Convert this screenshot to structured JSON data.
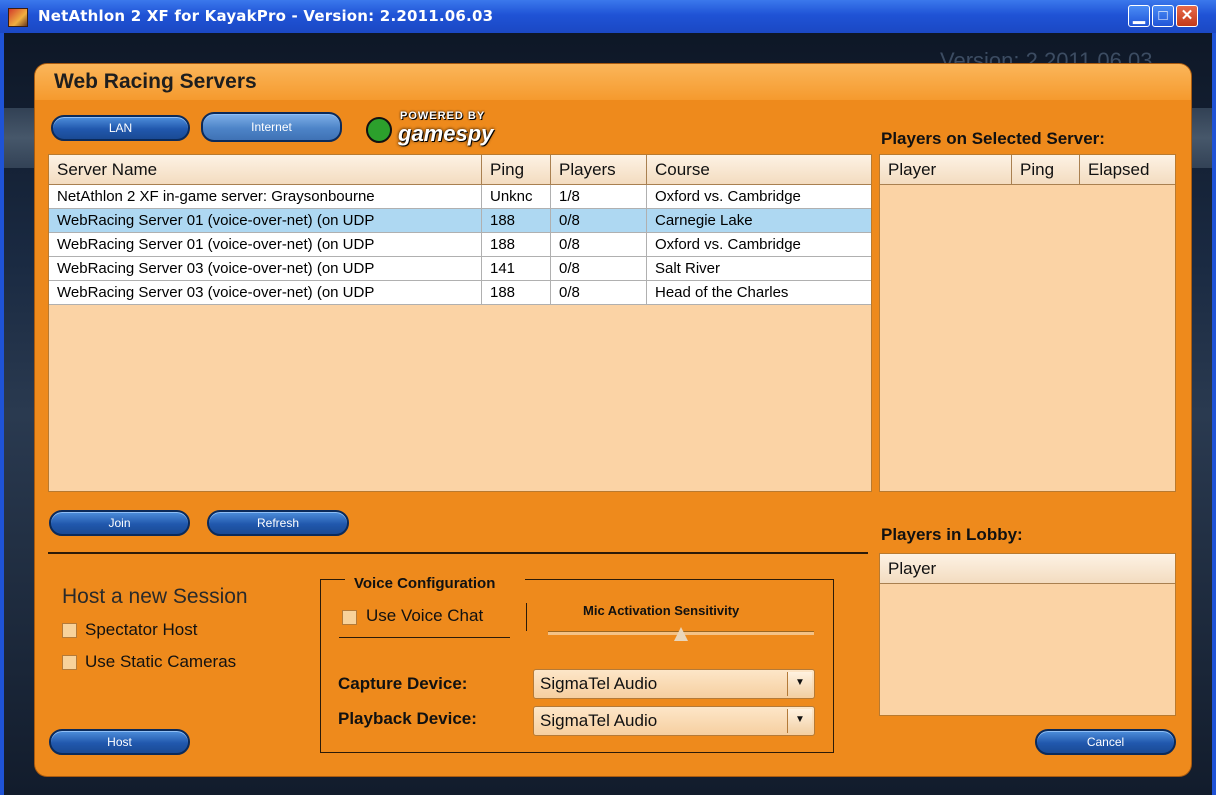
{
  "window": {
    "title": "NetAthlon 2 XF for KayakPro - Version: 2.2011.06.03",
    "background_version": "Version: 2.2011.06.03",
    "controls": [
      "minimize",
      "maximize",
      "close"
    ]
  },
  "dialog": {
    "title": "Web Racing Servers",
    "tabs": {
      "lan": "LAN",
      "internet": "Internet"
    },
    "logo": {
      "powered_by": "POWERED BY",
      "name": "gamespy"
    }
  },
  "servers": {
    "columns": [
      "Server Name",
      "Ping",
      "Players",
      "Course"
    ],
    "rows": [
      {
        "name": "NetAthlon 2 XF in-game server: Graysonbourne",
        "ping": "Unknc",
        "players": "1/8",
        "course": "Oxford vs. Cambridge",
        "selected": false
      },
      {
        "name": "WebRacing Server 01 (voice-over-net) (on UDP",
        "ping": "188",
        "players": "0/8",
        "course": "Carnegie Lake",
        "selected": true
      },
      {
        "name": "WebRacing Server 01 (voice-over-net) (on UDP",
        "ping": "188",
        "players": "0/8",
        "course": "Oxford vs. Cambridge",
        "selected": false
      },
      {
        "name": "WebRacing Server 03 (voice-over-net) (on UDP",
        "ping": "141",
        "players": "0/8",
        "course": "Salt River",
        "selected": false
      },
      {
        "name": "WebRacing Server 03 (voice-over-net) (on UDP",
        "ping": "188",
        "players": "0/8",
        "course": "Head of the Charles",
        "selected": false
      }
    ]
  },
  "players_selected": {
    "heading": "Players on Selected Server:",
    "columns": [
      "Player",
      "Ping",
      "Elapsed"
    ]
  },
  "lobby": {
    "heading": "Players in Lobby:",
    "columns": [
      "Player"
    ]
  },
  "buttons": {
    "join": "Join",
    "refresh": "Refresh",
    "host": "Host",
    "cancel": "Cancel"
  },
  "host_session": {
    "heading": "Host a new Session",
    "spectator_host": "Spectator Host",
    "use_static_cameras": "Use Static Cameras"
  },
  "voice": {
    "title": "Voice Configuration",
    "use_voice_chat": "Use Voice Chat",
    "mic_label": "Mic Activation Sensitivity",
    "mic_sensitivity": 0.5,
    "capture_label": "Capture Device:",
    "capture_value": "SigmaTel Audio",
    "playback_label": "Playback Device:",
    "playback_value": "SigmaTel Audio"
  }
}
